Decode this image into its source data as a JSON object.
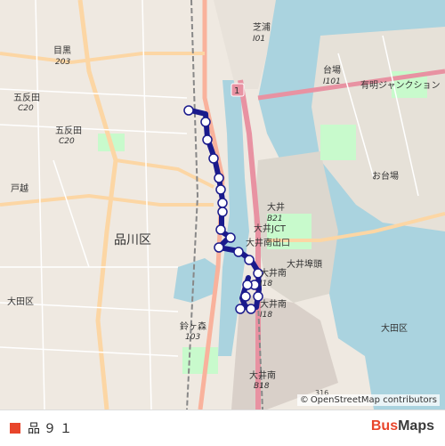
{
  "map": {
    "labels": {
      "shiba_ura": "芝浦",
      "shiba_ura_code": "I01",
      "daiba": "台場",
      "daiba_code": "I101",
      "ariake": "有明ジャンクション",
      "odaiba": "お台場",
      "meguro": "目黒",
      "meguro_code": "203",
      "gotanda": "五反田",
      "gotanda_code": "C20",
      "gotanda2": "五反田",
      "gotanda2_code": "C20",
      "shinagawa_ku": "品川区",
      "oi": "大井",
      "oi_code": "B21",
      "oi_jct": "大井JCT",
      "oi_minami_iriguchi": "大井南出口",
      "oi_futo": "大井埠頭",
      "oi_minami": "大井南",
      "oi_minami_code": "I18",
      "oi_minami2": "大井南",
      "oi_minami2_code": "I18",
      "suzugamori": "鈴ヶ森",
      "suzugamori_code": "103",
      "oi_bottom": "大井南",
      "oi_bottom_code": "B18",
      "ota": "大田区",
      "ota2": "大田区",
      "road_316": "316",
      "road_1": "1",
      "gotanda_left": "戸越"
    },
    "attribution": "OpenStreetMap contributors",
    "attribution_symbol": "©"
  },
  "route": {
    "name": "品９１",
    "color": "#e8452b",
    "line_color": "#1a1a8c"
  },
  "brand": {
    "part1": "Bus",
    "part2": "Maps"
  }
}
